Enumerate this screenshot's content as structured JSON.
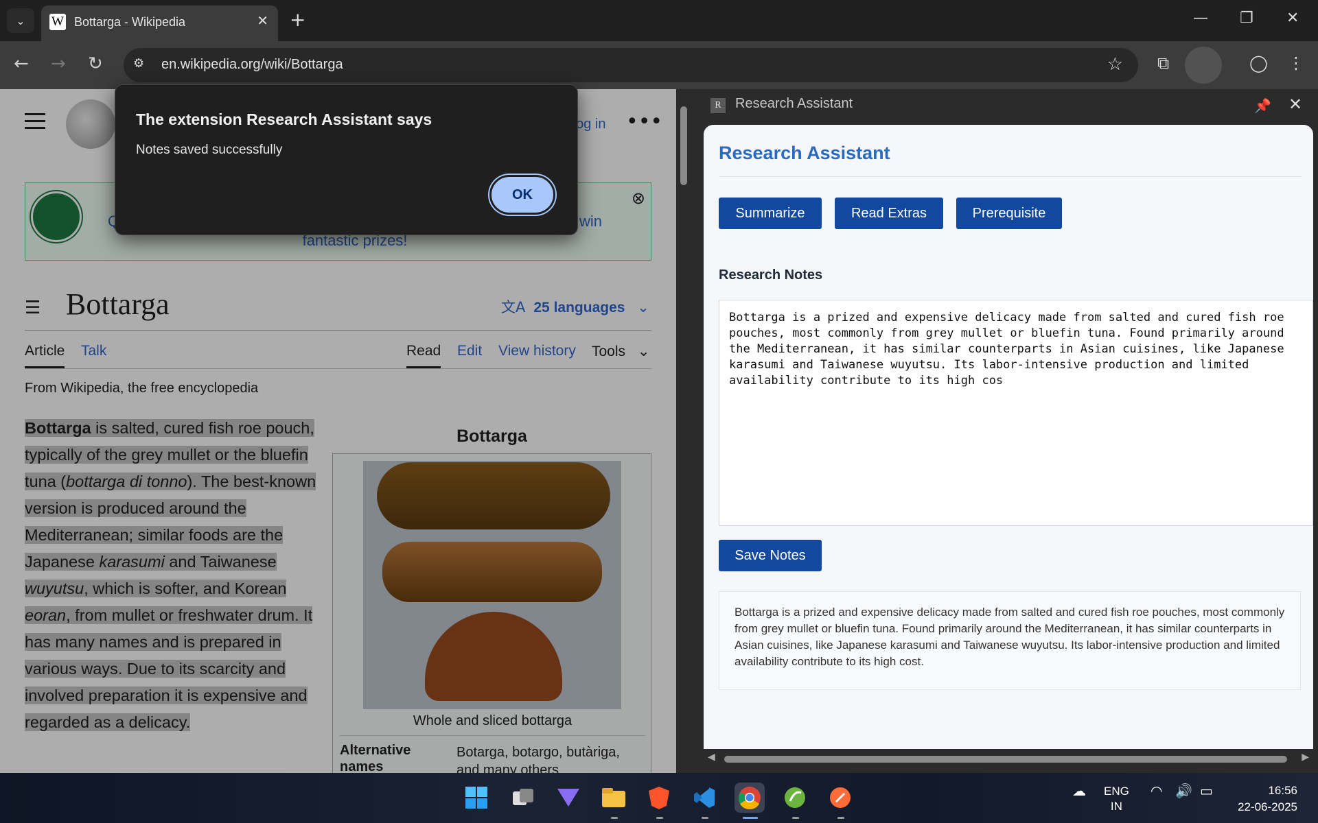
{
  "browser": {
    "tab_title": "Bottarga - Wikipedia",
    "url": "en.wikipedia.org/wiki/Bottarga"
  },
  "wiki": {
    "login": "Log in",
    "banner_text_left": "Q",
    "banner_text_right": "nd win",
    "banner_text_line2": "fantastic prizes!",
    "title": "Bottarga",
    "languages": "25 languages",
    "tabs": {
      "article": "Article",
      "talk": "Talk",
      "read": "Read",
      "edit": "Edit",
      "history": "View history",
      "tools": "Tools"
    },
    "from": "From Wikipedia, the free encyclopedia",
    "body": {
      "b1": "Bottarga",
      "t1": " is salted, cured fish roe pouch, typically of the grey mullet or the bluefin tuna (",
      "i1": "bottarga di tonno",
      "t2": "). The best-known version is produced around the Mediterranean; similar foods are the Japanese ",
      "i2": "karasumi",
      "t3": " and Taiwanese ",
      "i3": "wuyutsu",
      "t4": ", which is softer, and Korean ",
      "i4": "eoran",
      "t5": ", from mullet or freshwater drum. It has many names and is prepared in various ways. Due to its scarcity and involved preparation it is expensive and regarded as a delicacy."
    },
    "infobox": {
      "title": "Bottarga",
      "caption": "Whole and sliced bottarga",
      "alt_label": "Alternative names",
      "alt_value": "Botarga, botargo, butàriga, and many others"
    }
  },
  "side_panel": {
    "header": "Research Assistant",
    "header_badge": "R",
    "title": "Research Assistant",
    "buttons": {
      "summarize": "Summarize",
      "read_extras": "Read Extras",
      "prerequisite": "Prerequisite",
      "save": "Save Notes"
    },
    "notes_label": "Research Notes",
    "notes_value": "Bottarga is a prized and expensive delicacy made from salted and cured fish roe pouches, most commonly from grey mullet or bluefin tuna. Found primarily around the Mediterranean, it has similar counterparts in Asian cuisines, like Japanese karasumi and Taiwanese wuyutsu. Its labor-intensive production and limited availability contribute to its high cos",
    "summary": "Bottarga is a prized and expensive delicacy made from salted and cured fish roe pouches, most commonly from grey mullet or bluefin tuna. Found primarily around the Mediterranean, it has similar counterparts in Asian cuisines, like Japanese karasumi and Taiwanese wuyutsu. Its labor-intensive production and limited availability contribute to its high cost."
  },
  "dialog": {
    "title": "The extension Research Assistant says",
    "message": "Notes saved successfully",
    "ok": "OK"
  },
  "taskbar": {
    "lang_top": "ENG",
    "lang_bottom": "IN",
    "time": "16:56",
    "date": "22-06-2025"
  },
  "icons": {
    "tab_search": "chevron-down-icon",
    "favicon": "W",
    "close": "✕",
    "plus": "+",
    "minimize": "—",
    "restore": "❐",
    "back": "←",
    "forward": "→",
    "reload": "↻",
    "site_info": "⚙",
    "star": "☆",
    "extensions": "⧉",
    "profile": "◯",
    "menu": "⋮",
    "more": "•••",
    "banner_close": "⊗",
    "toc": "☰",
    "translate": "文A",
    "chevron": "⌄",
    "pin": "📌"
  },
  "colors": {
    "accent": "#12499e",
    "link": "#3366cc",
    "dialog_button": "#a8c7fa"
  }
}
